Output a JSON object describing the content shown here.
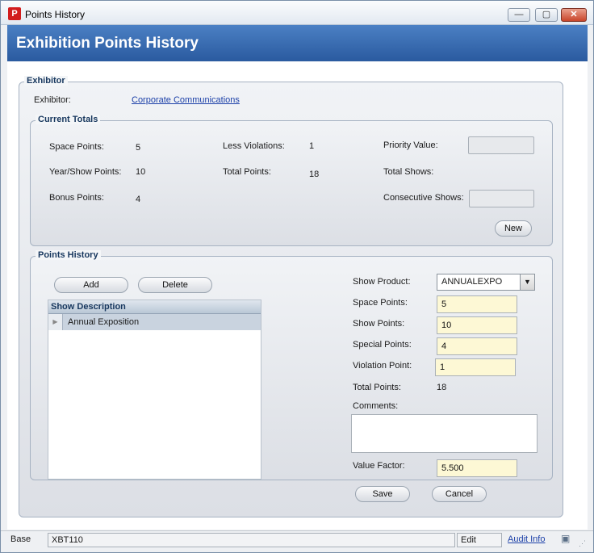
{
  "window": {
    "title": "Points History",
    "app_icon_letter": "P",
    "buttons": {
      "minimize": "—",
      "maximize": "▢",
      "close": "✕"
    }
  },
  "header": {
    "title": "Exhibition Points History"
  },
  "exhibitor_group": {
    "label": "Exhibitor",
    "exhibitor_label": "Exhibitor:",
    "exhibitor_value": "Corporate Communications"
  },
  "current_totals": {
    "label": "Current Totals",
    "space_points_label": "Space Points:",
    "space_points_value": "5",
    "year_show_points_label": "Year/Show Points:",
    "year_show_points_value": "10",
    "bonus_points_label": "Bonus Points:",
    "bonus_points_value": "4",
    "less_violations_label": "Less Violations:",
    "less_violations_value": "1",
    "total_points_label": "Total Points:",
    "total_points_value": "18",
    "priority_value_label": "Priority Value:",
    "priority_value_value": "",
    "total_shows_label": "Total Shows:",
    "consecutive_shows_label": "Consecutive Shows:",
    "consecutive_shows_value": "",
    "new_button": "New"
  },
  "points_history": {
    "label": "Points History",
    "add_button": "Add",
    "delete_button": "Delete",
    "grid": {
      "column": "Show Description",
      "rows": [
        "Annual Exposition"
      ]
    },
    "show_product_label": "Show Product:",
    "show_product_value": "ANNUALEXPO",
    "space_points_label": "Space Points:",
    "space_points_value": "5",
    "show_points_label": "Show Points:",
    "show_points_value": "10",
    "special_points_label": "Special Points:",
    "special_points_value": "4",
    "violation_point_label": "Violation Point:",
    "violation_point_value": "1",
    "total_points_label": "Total Points:",
    "total_points_value": "18",
    "comments_label": "Comments:",
    "comments_value": "",
    "value_factor_label": "Value Factor:",
    "value_factor_value": "5.500"
  },
  "actions": {
    "save": "Save",
    "cancel": "Cancel"
  },
  "statusbar": {
    "base": "Base",
    "record_id": "XBT110",
    "mode": "Edit",
    "audit_link": "Audit Info"
  },
  "colors": {
    "header_blue": "#2a5a9f",
    "field_yellow": "#fdf8d5",
    "group_label": "#17375e",
    "link_blue": "#1b3fa8"
  }
}
